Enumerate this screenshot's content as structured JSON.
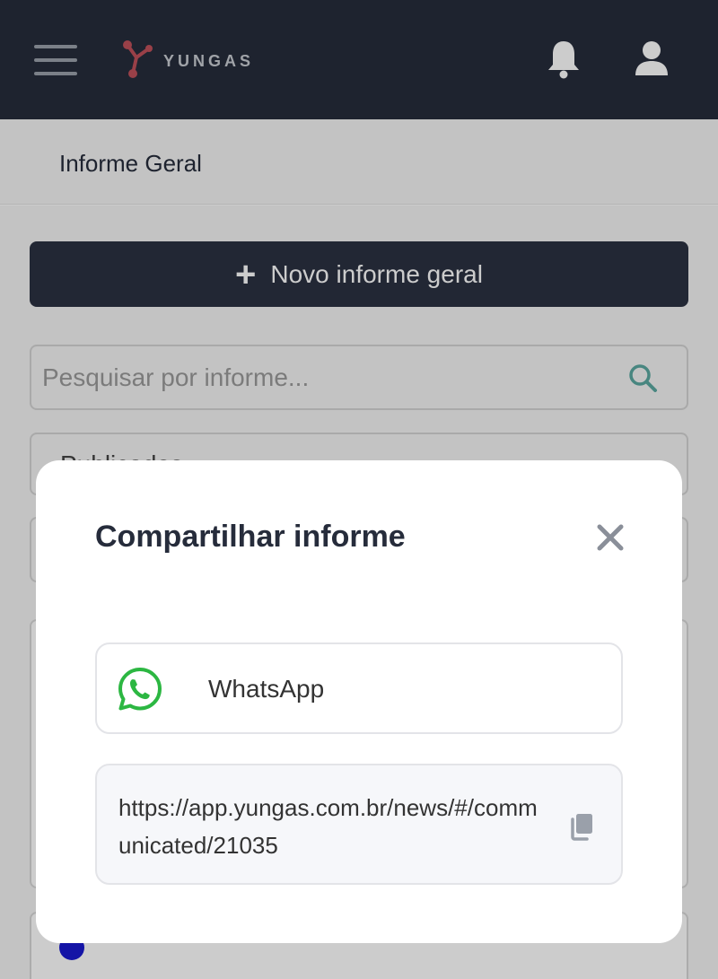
{
  "header": {
    "logo_text": "YUNGAS"
  },
  "subheader": {
    "title": "Informe Geral"
  },
  "toolbar": {
    "new_button_label": "Novo informe geral"
  },
  "search": {
    "placeholder": "Pesquisar por informe..."
  },
  "filter": {
    "selected": "Publicados"
  },
  "modal": {
    "title": "Compartilhar informe",
    "whatsapp_label": "WhatsApp",
    "share_url": "https://app.yungas.com.br/news/#/communicated/21035"
  },
  "colors": {
    "header_bg": "#262c3b",
    "primary_button": "#2b3142",
    "whatsapp_green": "#2cb742",
    "logo_accent": "#c0505a"
  },
  "icons": {
    "menu": "hamburger-menu-icon",
    "notifications": "bell-icon",
    "profile": "user-icon",
    "search": "search-icon",
    "close": "close-icon",
    "share_whatsapp": "whatsapp-icon",
    "copy": "copy-icon"
  }
}
